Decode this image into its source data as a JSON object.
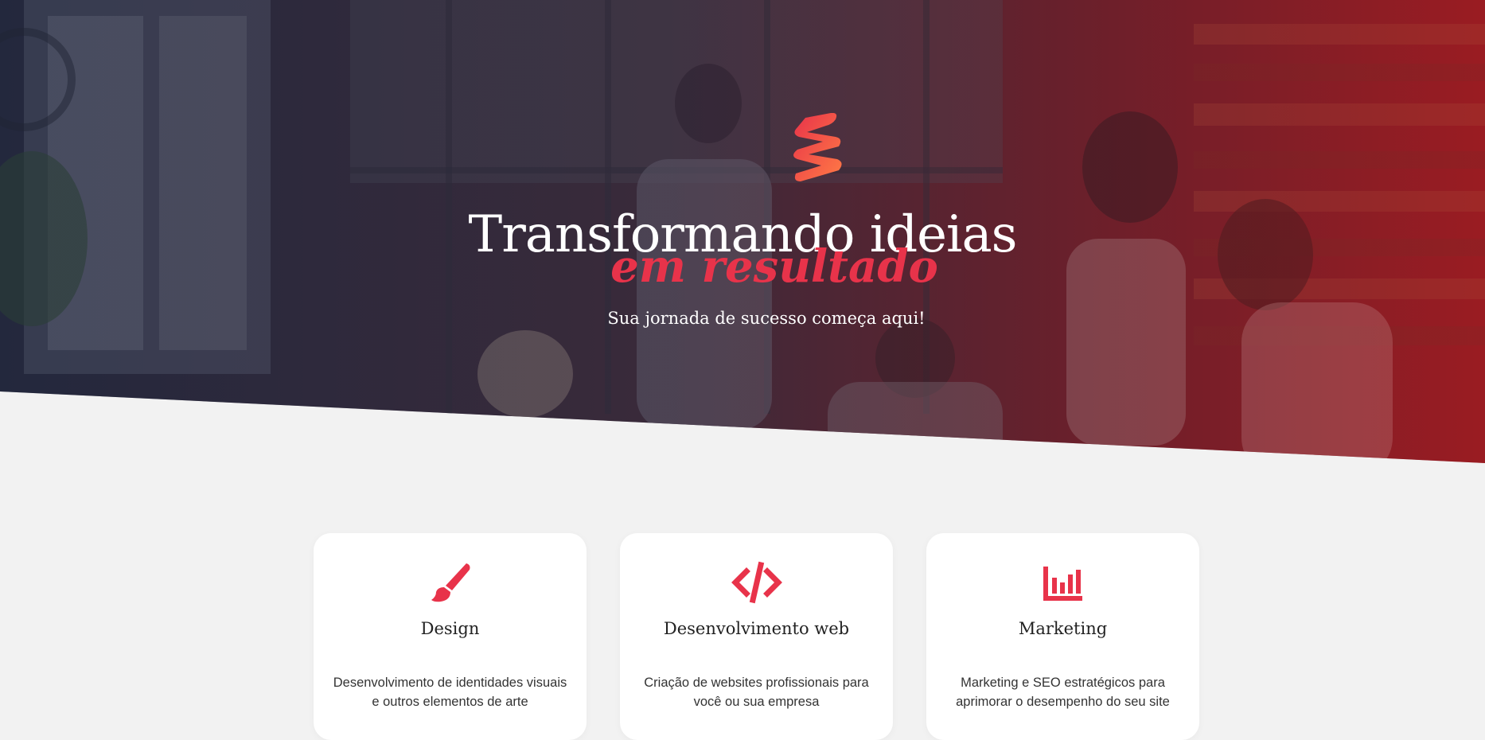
{
  "hero": {
    "title": "Transformando ideias",
    "highlight": "em resultado",
    "tagline": "Sua jornada de sucesso começa aqui!"
  },
  "colors": {
    "accent": "#e8334a",
    "accent_gradient_end": "#ff7a45",
    "overlay_dark": "#1f2236",
    "overlay_red": "#8e1a22",
    "page_bg": "#f2f2f2"
  },
  "services": [
    {
      "icon": "paintbrush-icon",
      "name": "Design",
      "desc_line1": "Desenvolvimento de identidades visuais",
      "desc_line2": "e outros elementos de arte"
    },
    {
      "icon": "code-icon",
      "name": "Desenvolvimento web",
      "desc_line1": "Criação de websites profissionais para",
      "desc_line2": "você ou sua empresa"
    },
    {
      "icon": "chart-icon",
      "name": "Marketing",
      "desc_line1": "Marketing e SEO estratégicos para",
      "desc_line2": "aprimorar o desempenho do seu site"
    }
  ]
}
